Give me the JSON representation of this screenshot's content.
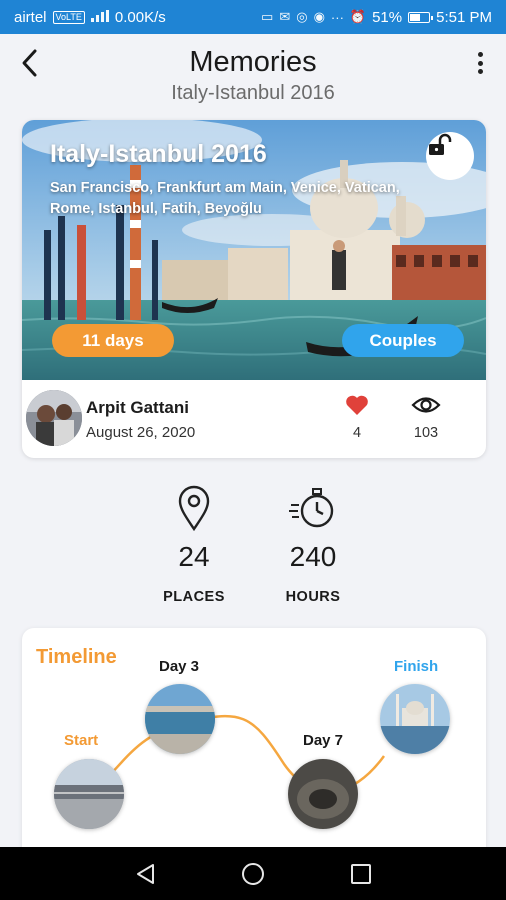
{
  "status_bar": {
    "carrier": "airtel",
    "volte": "VoLTE",
    "network": "4G",
    "speed": "0.00K/s",
    "battery": "51%",
    "battery_level": 0.51,
    "time": "5:51 PM"
  },
  "header": {
    "title": "Memories",
    "subtitle": "Italy-Istanbul 2016"
  },
  "trip": {
    "title": "Italy-Istanbul 2016",
    "cities": "San Francisco, Frankfurt am Main, Venice, Vatican, Rome, Istanbul, Fatih, Beyoğlu",
    "duration": "11 days",
    "travel_type": "Couples",
    "author_name": "Arpit Gattani",
    "date": "August 26, 2020",
    "likes": "4",
    "views": "103"
  },
  "stats": {
    "places_value": "24",
    "places_label": "PLACES",
    "hours_value": "240",
    "hours_label": "HOURS"
  },
  "timeline": {
    "title": "Timeline",
    "stops": [
      {
        "label": "Start"
      },
      {
        "label": "Day 3"
      },
      {
        "label": "Day 7"
      },
      {
        "label": "Finish"
      }
    ]
  },
  "colors": {
    "status_bar": "#1f84d4",
    "accent_orange": "#f39a34",
    "accent_blue": "#30a4ec",
    "heart": "#e0413a"
  }
}
